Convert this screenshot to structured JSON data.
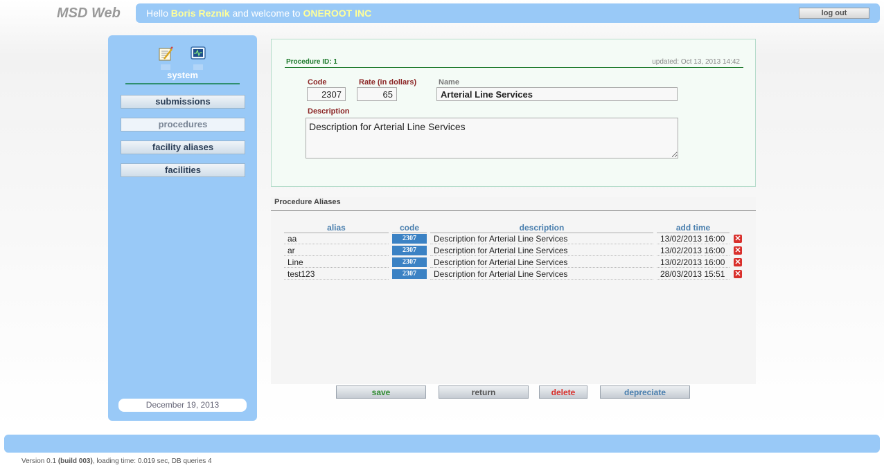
{
  "header": {
    "app_title": "MSD Web",
    "greeting_pre": "Hello ",
    "user_name": "Boris Reznik",
    "greeting_mid": " and welcome to ",
    "company": "ONEROOT INC",
    "logout_label": "log out"
  },
  "sidebar": {
    "section_label": "system",
    "icons": [
      "notepad-icon",
      "monitor-icon"
    ],
    "items": [
      {
        "label": "submissions",
        "active": false
      },
      {
        "label": "procedures",
        "active": true
      },
      {
        "label": "facility aliases",
        "active": false
      },
      {
        "label": "facilities",
        "active": false
      }
    ],
    "date": "December 19, 2013"
  },
  "procedure": {
    "id_label": "Procedure ID: 1",
    "updated": "updated: Oct 13, 2013 14:42",
    "code_label": "Code",
    "code_value": "2307",
    "rate_label": "Rate (in dollars)",
    "rate_value": "65",
    "name_label": "Name",
    "name_value": "Arterial Line Services",
    "description_label": "Description",
    "description_value": "Description for Arterial Line Services"
  },
  "aliases": {
    "title": "Procedure Aliases",
    "columns": [
      "alias",
      "code",
      "description",
      "add time"
    ],
    "rows": [
      {
        "alias": "aa",
        "code": "2307",
        "description": "Description for Arterial Line Services",
        "add_time": "13/02/2013 16:00"
      },
      {
        "alias": "ar",
        "code": "2307",
        "description": "Description for Arterial Line Services",
        "add_time": "13/02/2013 16:00"
      },
      {
        "alias": "Line",
        "code": "2307",
        "description": "Description for Arterial Line Services",
        "add_time": "13/02/2013 16:00"
      },
      {
        "alias": "test123",
        "code": "2307",
        "description": "Description for Arterial Line Services",
        "add_time": "28/03/2013 15:51"
      }
    ]
  },
  "actions": {
    "save": "save",
    "return": "return",
    "delete": "delete",
    "depreciate": "depreciate"
  },
  "colors": {
    "save": "#2e8b2e",
    "return": "#555555",
    "delete": "#d9302c",
    "depreciate": "#4a7fae"
  },
  "footer": {
    "version_pre": "Version 0.1 ",
    "build": "(build 003)",
    "version_post": ", loading time: 0.019 sec, DB queries 4"
  }
}
